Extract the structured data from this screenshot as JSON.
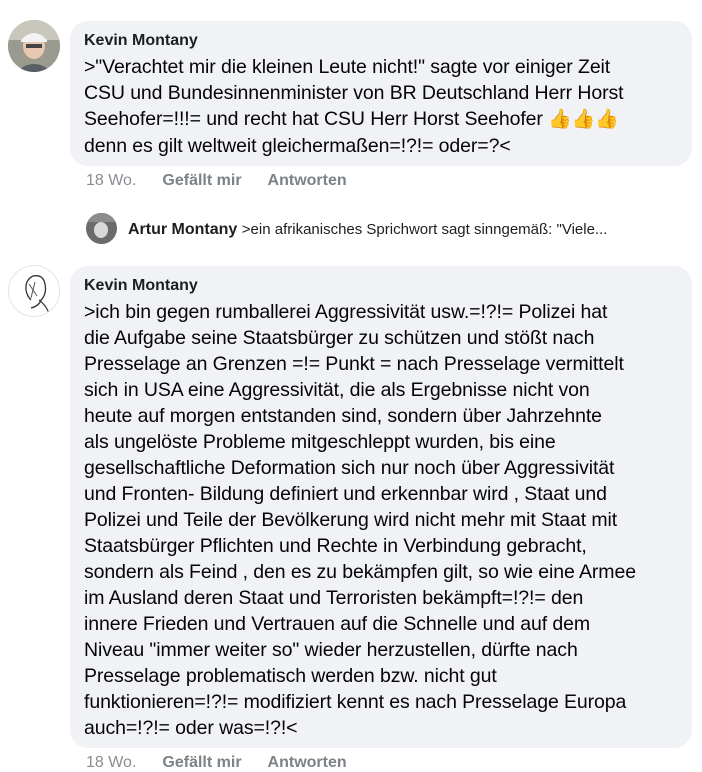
{
  "comments": [
    {
      "author": "Kevin Montany",
      "text": ">\"Verachtet mir die kleinen Leute nicht!\" sagte vor einiger Zeit\nCSU und Bundesinnenminister von BR Deutschland Herr Horst\nSeehofer=!!!= und recht hat CSU Herr Horst Seehofer ",
      "text_end": "\ndenn es gilt weltweit gleichermaßen=!?!= oder=?<",
      "emoji": "👍👍👍",
      "time": "18 Wo.",
      "like_label": "Gefällt mir",
      "reply_label": "Antworten"
    },
    {
      "author": "Kevin Montany",
      "text": ">ich bin gegen rumballerei Aggressivität usw.=!?!=  Polizei hat\ndie Aufgabe seine Staatsbürger zu schützen und stößt nach\nPresselage an Grenzen =!= Punkt = nach Presselage vermittelt\nsich in USA eine Aggressivität, die als Ergebnisse nicht von\nheute auf morgen entstanden sind, sondern  über Jahrzehnte\nals ungelöste Probleme mitgeschleppt wurden, bis eine\ngesellschaftliche Deformation sich nur noch über  Aggressivität\nund Fronten- Bildung definiert und erkennbar wird , Staat und\nPolizei und Teile der Bevölkerung wird nicht mehr mit Staat mit\nStaatsbürger Pflichten und Rechte in Verbindung gebracht,\nsondern als Feind , den es zu bekämpfen gilt, so wie eine Armee\nim Ausland deren Staat und Terroristen bekämpft=!?!= den\ninnere Frieden und Vertrauen auf die Schnelle und auf dem\nNiveau \"immer weiter so\" wieder herzustellen, dürfte nach\nPresselage problematisch werden bzw. nicht gut\nfunktionieren=!?!= modifiziert kennt es nach Presselage Europa\nauch=!?!= oder was=!?!<",
      "time": "18 Wo.",
      "like_label": "Gefällt mir",
      "reply_label": "Antworten"
    }
  ],
  "reply_preview": {
    "author": "Artur Montany",
    "snippet": ">ein afrikanisches Sprichwort sagt sinngemäß: \"Viele..."
  },
  "colors": {
    "bubble": "#f0f2f5",
    "meta": "#7d8288"
  },
  "icons": [
    "avatar-photo",
    "avatar-line-drawing",
    "thumbs-up-emoji"
  ]
}
